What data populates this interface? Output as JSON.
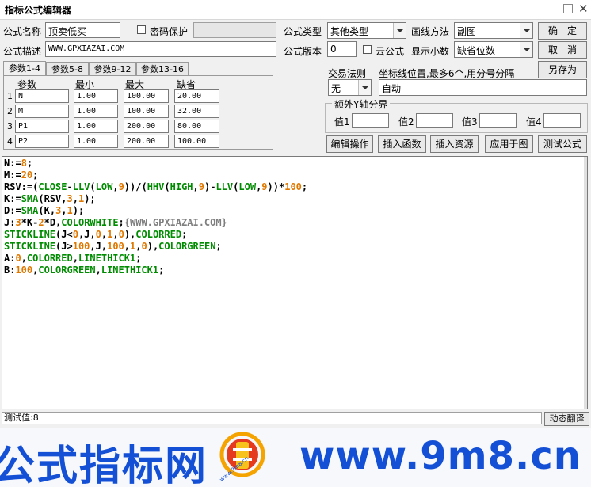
{
  "window": {
    "title": "指标公式编辑器"
  },
  "form": {
    "name_label": "公式名称",
    "name_value": "顶卖低买",
    "password_label": "密码保护",
    "desc_label": "公式描述",
    "desc_value": "WWW.GPXIAZAI.COM",
    "type_label": "公式类型",
    "type_value": "其他类型",
    "version_label": "公式版本",
    "version_value": "0",
    "cloud_label": "云公式",
    "draw_label": "画线方法",
    "draw_value": "副图",
    "decimal_label": "显示小数",
    "decimal_value": "缺省位数"
  },
  "buttons": {
    "ok": "确　定",
    "cancel": "取　消",
    "saveas": "另存为"
  },
  "tabs": [
    "参数1-4",
    "参数5-8",
    "参数9-12",
    "参数13-16"
  ],
  "params": {
    "headers": [
      "参数",
      "最小",
      "最大",
      "缺省"
    ],
    "rows": [
      {
        "num": "1",
        "name": "N",
        "min": "1.00",
        "max": "100.00",
        "def": "20.00"
      },
      {
        "num": "2",
        "name": "M",
        "min": "1.00",
        "max": "100.00",
        "def": "32.00"
      },
      {
        "num": "3",
        "name": "P1",
        "min": "1.00",
        "max": "200.00",
        "def": "80.00"
      },
      {
        "num": "4",
        "name": "P2",
        "min": "1.00",
        "max": "200.00",
        "def": "100.00"
      }
    ]
  },
  "trade": {
    "rule_label": "交易法则",
    "rule_value": "无",
    "coord_label": "坐标线位置,最多6个,用分号分隔",
    "coord_value": "自动"
  },
  "yaxis": {
    "title": "额外Y轴分界",
    "labels": [
      "值1",
      "值2",
      "值3",
      "值4"
    ]
  },
  "actions": [
    "编辑操作",
    "插入函数",
    "插入资源",
    "应用于图",
    "测试公式"
  ],
  "code": [
    [
      [
        "N:=",
        "#000000"
      ],
      [
        "8",
        "#e07800"
      ],
      [
        ";",
        "#000000"
      ]
    ],
    [
      [
        "M:=",
        "#000000"
      ],
      [
        "20",
        "#e07800"
      ],
      [
        ";",
        "#000000"
      ]
    ],
    [
      [
        "RSV:=(",
        "#000000"
      ],
      [
        "CLOSE",
        "#008c00"
      ],
      [
        "-",
        "#000000"
      ],
      [
        "LLV",
        "#008c00"
      ],
      [
        "(",
        "#000000"
      ],
      [
        "LOW",
        "#008c00"
      ],
      [
        ",",
        "#000000"
      ],
      [
        "9",
        "#e07800"
      ],
      [
        "))/(",
        "#000000"
      ],
      [
        "HHV",
        "#008c00"
      ],
      [
        "(",
        "#000000"
      ],
      [
        "HIGH",
        "#008c00"
      ],
      [
        ",",
        "#000000"
      ],
      [
        "9",
        "#e07800"
      ],
      [
        ")-",
        "#000000"
      ],
      [
        "LLV",
        "#008c00"
      ],
      [
        "(",
        "#000000"
      ],
      [
        "LOW",
        "#008c00"
      ],
      [
        ",",
        "#000000"
      ],
      [
        "9",
        "#e07800"
      ],
      [
        "))*",
        "#000000"
      ],
      [
        "100",
        "#e07800"
      ],
      [
        ";",
        "#000000"
      ]
    ],
    [
      [
        "K:=",
        "#000000"
      ],
      [
        "SMA",
        "#008c00"
      ],
      [
        "(RSV,",
        "#000000"
      ],
      [
        "3",
        "#e07800"
      ],
      [
        ",",
        "#000000"
      ],
      [
        "1",
        "#e07800"
      ],
      [
        ");",
        "#000000"
      ]
    ],
    [
      [
        "D:=",
        "#000000"
      ],
      [
        "SMA",
        "#008c00"
      ],
      [
        "(K,",
        "#000000"
      ],
      [
        "3",
        "#e07800"
      ],
      [
        ",",
        "#000000"
      ],
      [
        "1",
        "#e07800"
      ],
      [
        ");",
        "#000000"
      ]
    ],
    [
      [
        "J:",
        "#000000"
      ],
      [
        "3",
        "#e07800"
      ],
      [
        "*K-",
        "#000000"
      ],
      [
        "2",
        "#e07800"
      ],
      [
        "*D,",
        "#000000"
      ],
      [
        "COLORWHITE",
        "#008c00"
      ],
      [
        ";",
        "#000000"
      ],
      [
        "{WWW.GPXIAZAI.COM}",
        "#7f7f7f"
      ]
    ],
    [
      [
        "STICKLINE",
        "#008c00"
      ],
      [
        "(J<",
        "#000000"
      ],
      [
        "0",
        "#e07800"
      ],
      [
        ",J,",
        "#000000"
      ],
      [
        "0",
        "#e07800"
      ],
      [
        ",",
        "#000000"
      ],
      [
        "1",
        "#e07800"
      ],
      [
        ",",
        "#000000"
      ],
      [
        "0",
        "#e07800"
      ],
      [
        "),",
        "#000000"
      ],
      [
        "COLORRED",
        "#008c00"
      ],
      [
        ";",
        "#000000"
      ]
    ],
    [
      [
        "STICKLINE",
        "#008c00"
      ],
      [
        "(J>",
        "#000000"
      ],
      [
        "100",
        "#e07800"
      ],
      [
        ",J,",
        "#000000"
      ],
      [
        "100",
        "#e07800"
      ],
      [
        ",",
        "#000000"
      ],
      [
        "1",
        "#e07800"
      ],
      [
        ",",
        "#000000"
      ],
      [
        "0",
        "#e07800"
      ],
      [
        "),",
        "#000000"
      ],
      [
        "COLORGREEN",
        "#008c00"
      ],
      [
        ";",
        "#000000"
      ]
    ],
    [
      [
        "A:",
        "#000000"
      ],
      [
        "0",
        "#e07800"
      ],
      [
        ",",
        "#000000"
      ],
      [
        "COLORRED",
        "#008c00"
      ],
      [
        ",",
        "#000000"
      ],
      [
        "LINETHICK1",
        "#008c00"
      ],
      [
        ";",
        "#000000"
      ]
    ],
    [
      [
        "B:",
        "#000000"
      ],
      [
        "100",
        "#e07800"
      ],
      [
        ",",
        "#000000"
      ],
      [
        "COLORGREEN",
        "#008c00"
      ],
      [
        ",",
        "#000000"
      ],
      [
        "LINETHICK1",
        "#008c00"
      ],
      [
        ";",
        "#000000"
      ]
    ]
  ],
  "status": {
    "text": "测试值:8",
    "dynamic_btn": "动态翻译"
  },
  "watermark": {
    "left": "公式指标网",
    "right": "www.9m8.cn",
    "logo_text": "www.9m8.cn"
  },
  "colors": {
    "brand": "#1450d6",
    "number": "#e07800",
    "function": "#008c00",
    "comment": "#7f7f7f"
  }
}
